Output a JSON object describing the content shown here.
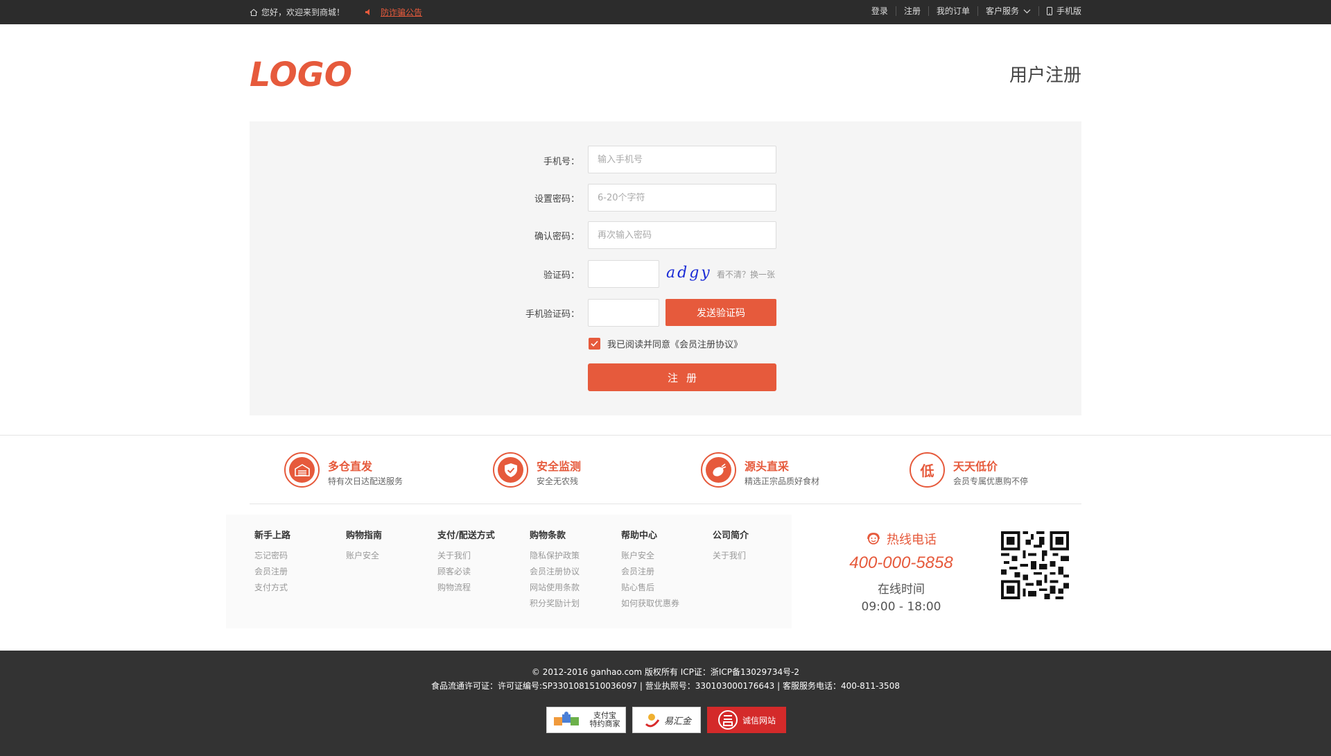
{
  "topbar": {
    "welcome": "您好，欢迎来到商城！",
    "notice_link": "防诈骗公告",
    "links": [
      {
        "label": "登录"
      },
      {
        "label": "注册"
      },
      {
        "label": "我的订单"
      },
      {
        "label": "客户服务"
      },
      {
        "label": "手机版"
      }
    ]
  },
  "header": {
    "logo_text": "LOGO",
    "page_title": "用户注册"
  },
  "form": {
    "phone_label": "手机号：",
    "phone_placeholder": "输入手机号",
    "password_label": "设置密码：",
    "password_placeholder": "6-20个字符",
    "confirm_label": "确认密码：",
    "confirm_placeholder": "再次输入密码",
    "captcha_label": "验证码：",
    "captcha_text": "adgy",
    "captcha_refresh": "看不清？换一张",
    "sms_label": "手机验证码：",
    "send_button": "发送验证码",
    "agree_text": "我已阅读并同意《会员注册协议》",
    "submit_button": "注册"
  },
  "features": [
    {
      "title": "多仓直发",
      "desc": "特有次日达配送服务",
      "icon": "warehouse-icon"
    },
    {
      "title": "安全监测",
      "desc": "安全无农残",
      "icon": "shield-check-icon"
    },
    {
      "title": "源头直采",
      "desc": "精选正宗品质好食材",
      "icon": "vegetable-icon"
    },
    {
      "title": "天天低价",
      "desc": "会员专属优惠购不停",
      "icon": "low-price-icon",
      "glyph": "低"
    }
  ],
  "footer_columns": [
    {
      "title": "新手上路",
      "items": [
        "忘记密码",
        "会员注册",
        "支付方式"
      ]
    },
    {
      "title": "购物指南",
      "items": [
        "账户安全"
      ]
    },
    {
      "title": "支付/配送方式",
      "items": [
        "关于我们",
        "顾客必读",
        "购物流程"
      ]
    },
    {
      "title": "购物条款",
      "items": [
        "隐私保护政策",
        "会员注册协议",
        "网站使用条款",
        "积分奖励计划"
      ]
    },
    {
      "title": "帮助中心",
      "items": [
        "账户安全",
        "会员注册",
        "贴心售后",
        "如何获取优惠券"
      ]
    },
    {
      "title": "公司简介",
      "items": [
        "关于我们"
      ]
    }
  ],
  "hotline": {
    "title": "热线电话",
    "number": "400-000-5858",
    "time_label": "在线时间",
    "time": "09:00 - 18:00"
  },
  "bottom": {
    "copyright": "© 2012-2016 ganhao.com 版权所有 ICP证：浙ICP备13029734号-2",
    "license": "食品流通许可证：许可证编号:SP3301081510036097 | 营业执照号：330103000176643 | 客服服务电话：400-811-3508",
    "badges": [
      {
        "label": "支付宝\n特约商家"
      },
      {
        "label": "易汇金"
      },
      {
        "label": "诚信网站"
      }
    ]
  },
  "colors": {
    "accent": "#e65a3c",
    "topbar_bg": "#2c2c2c",
    "panel_bg": "#f5f5f5",
    "bottom_bg": "#333333"
  }
}
